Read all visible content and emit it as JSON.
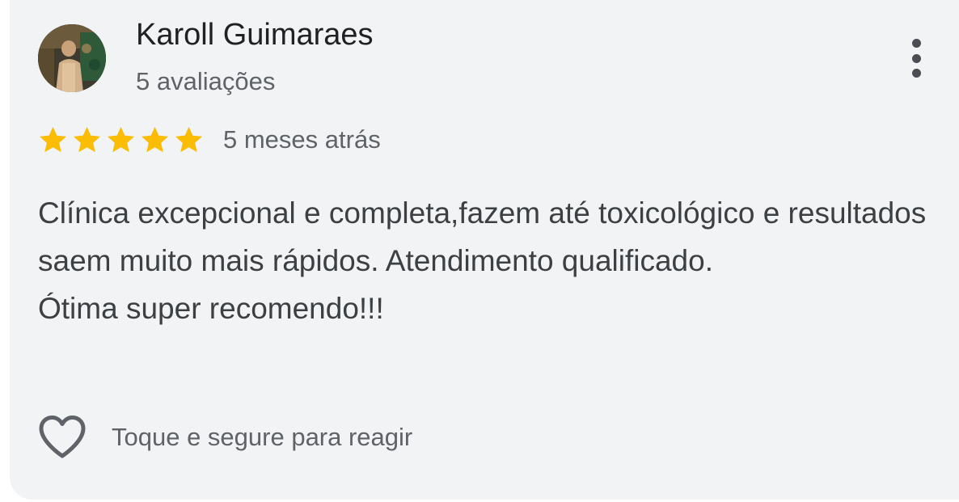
{
  "review": {
    "author_name": "Karoll Guimaraes",
    "review_count": "5 avaliações",
    "rating": 5,
    "rating_max": 5,
    "time_ago": "5 meses atrás",
    "text_paragraph_1": "Clínica excepcional e completa,fazem até toxicológico e resultados saem muito mais rápidos. Atendimento qualificado.",
    "text_paragraph_2": "Ótima super recomendo!!!",
    "react_label": "Toque e segure para reagir"
  },
  "icons": {
    "avatar": "user-photo-avatar",
    "menu": "more-vert-icon",
    "star": "star-icon",
    "react": "heart-outline-icon"
  },
  "colors": {
    "card_background": "#f2f3f5",
    "star_fill": "#fbbc04",
    "name_text": "#202124",
    "secondary_text": "#5f6368",
    "body_text": "#3c4043",
    "icon": "#4a4d52"
  }
}
